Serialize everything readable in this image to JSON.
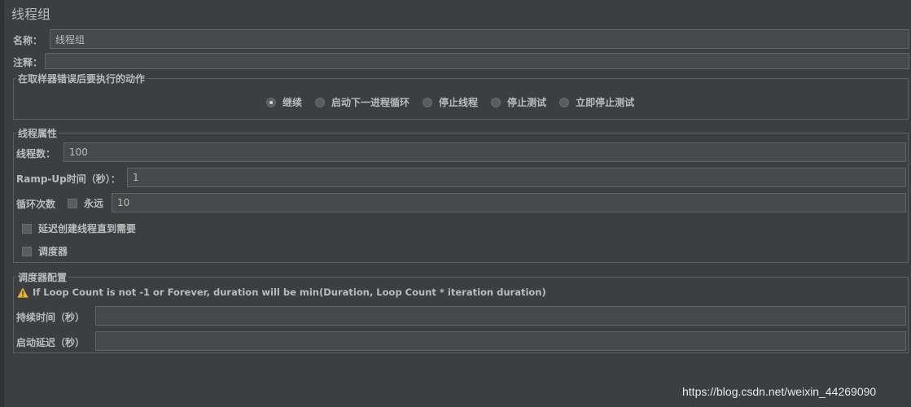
{
  "panel": {
    "title": "线程组"
  },
  "name_field": {
    "label": "名称：",
    "value": "线程组"
  },
  "comment_field": {
    "label": "注释：",
    "value": ""
  },
  "sampler_error": {
    "legend": "在取样器错误后要执行的动作",
    "options": [
      {
        "label": "继续",
        "selected": true
      },
      {
        "label": "启动下一进程循环",
        "selected": false
      },
      {
        "label": "停止线程",
        "selected": false
      },
      {
        "label": "停止测试",
        "selected": false
      },
      {
        "label": "立即停止测试",
        "selected": false
      }
    ]
  },
  "thread_props": {
    "legend": "线程属性",
    "threads": {
      "label": "线程数：",
      "value": "100"
    },
    "rampup": {
      "label": "Ramp-Up时间（秒）：",
      "value": "1"
    },
    "loop": {
      "label": "循环次数",
      "forever_label": "永远",
      "forever_checked": false,
      "value": "10"
    },
    "delay_create": {
      "label": "延迟创建线程直到需要",
      "checked": false
    },
    "scheduler": {
      "label": "调度器",
      "checked": false
    }
  },
  "scheduler_config": {
    "legend": "调度器配置",
    "warning": "If Loop Count is not -1 or Forever, duration will be min(Duration, Loop Count * iteration duration)",
    "duration": {
      "label": "持续时间（秒）",
      "value": ""
    },
    "startup_delay": {
      "label": "启动延迟（秒）",
      "value": ""
    }
  },
  "watermark": "https://blog.csdn.net/weixin_44269090",
  "colors": {
    "background": "#3c3f41",
    "field": "#45494a",
    "border": "#646464",
    "text": "#bbbbbb",
    "warning": "#e5b52d"
  }
}
